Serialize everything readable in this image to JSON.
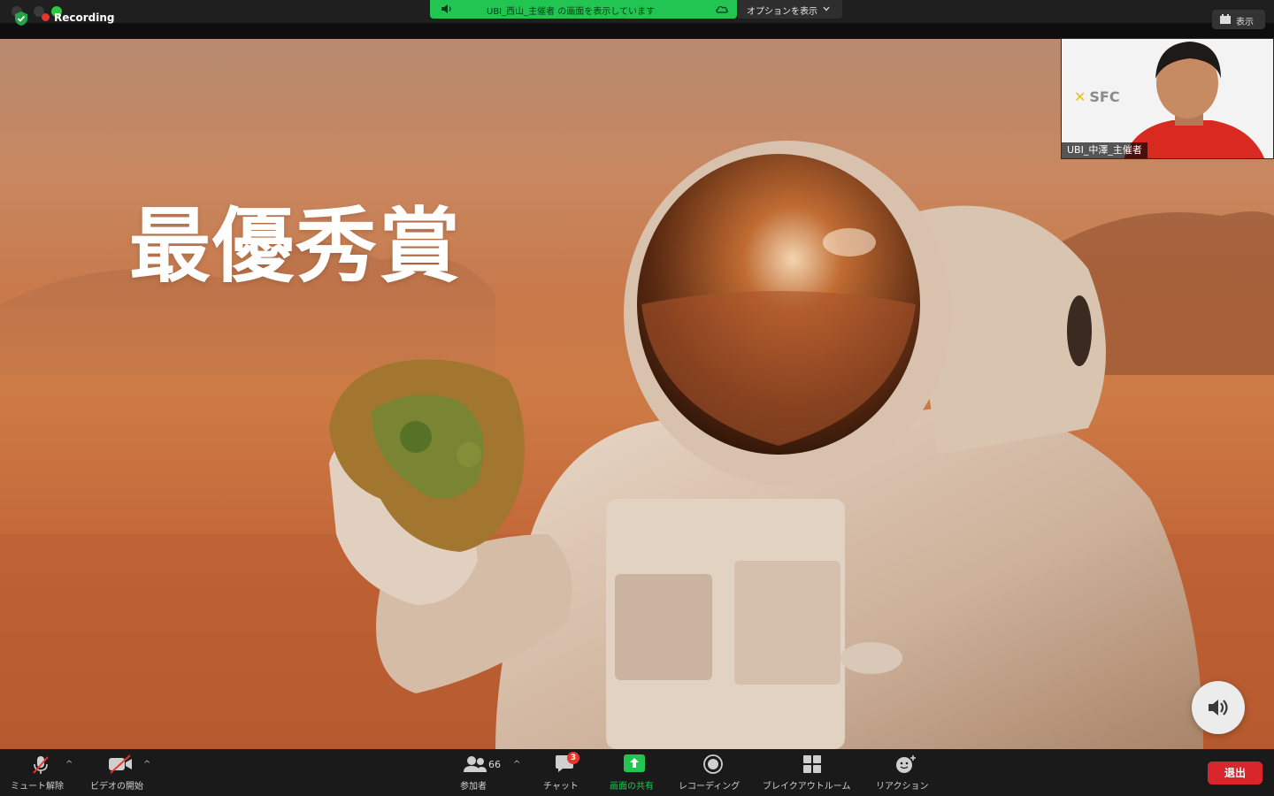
{
  "topbar": {
    "recording_label": "Recording",
    "share_banner_text": "UBI_西山_主催者 の画面を表示しています",
    "options_label": "オプションを表示",
    "view_label": "表示"
  },
  "shared_screen": {
    "headline": "最優秀賞"
  },
  "thumbnail": {
    "participant_name": "UBI_中澤_主催者",
    "logo_text": "SFC"
  },
  "toolbar": {
    "mute_label": "ミュート解除",
    "video_label": "ビデオの開始",
    "participants_label": "参加者",
    "participants_count": "66",
    "chat_label": "チャット",
    "chat_badge": "3",
    "share_label": "画面の共有",
    "record_label": "レコーディング",
    "breakout_label": "ブレイクアウトルーム",
    "reactions_label": "リアクション",
    "leave_label": "退出"
  },
  "colors": {
    "share_green": "#23c552",
    "leave_red": "#d8262c",
    "recording_red": "#e8352c"
  }
}
